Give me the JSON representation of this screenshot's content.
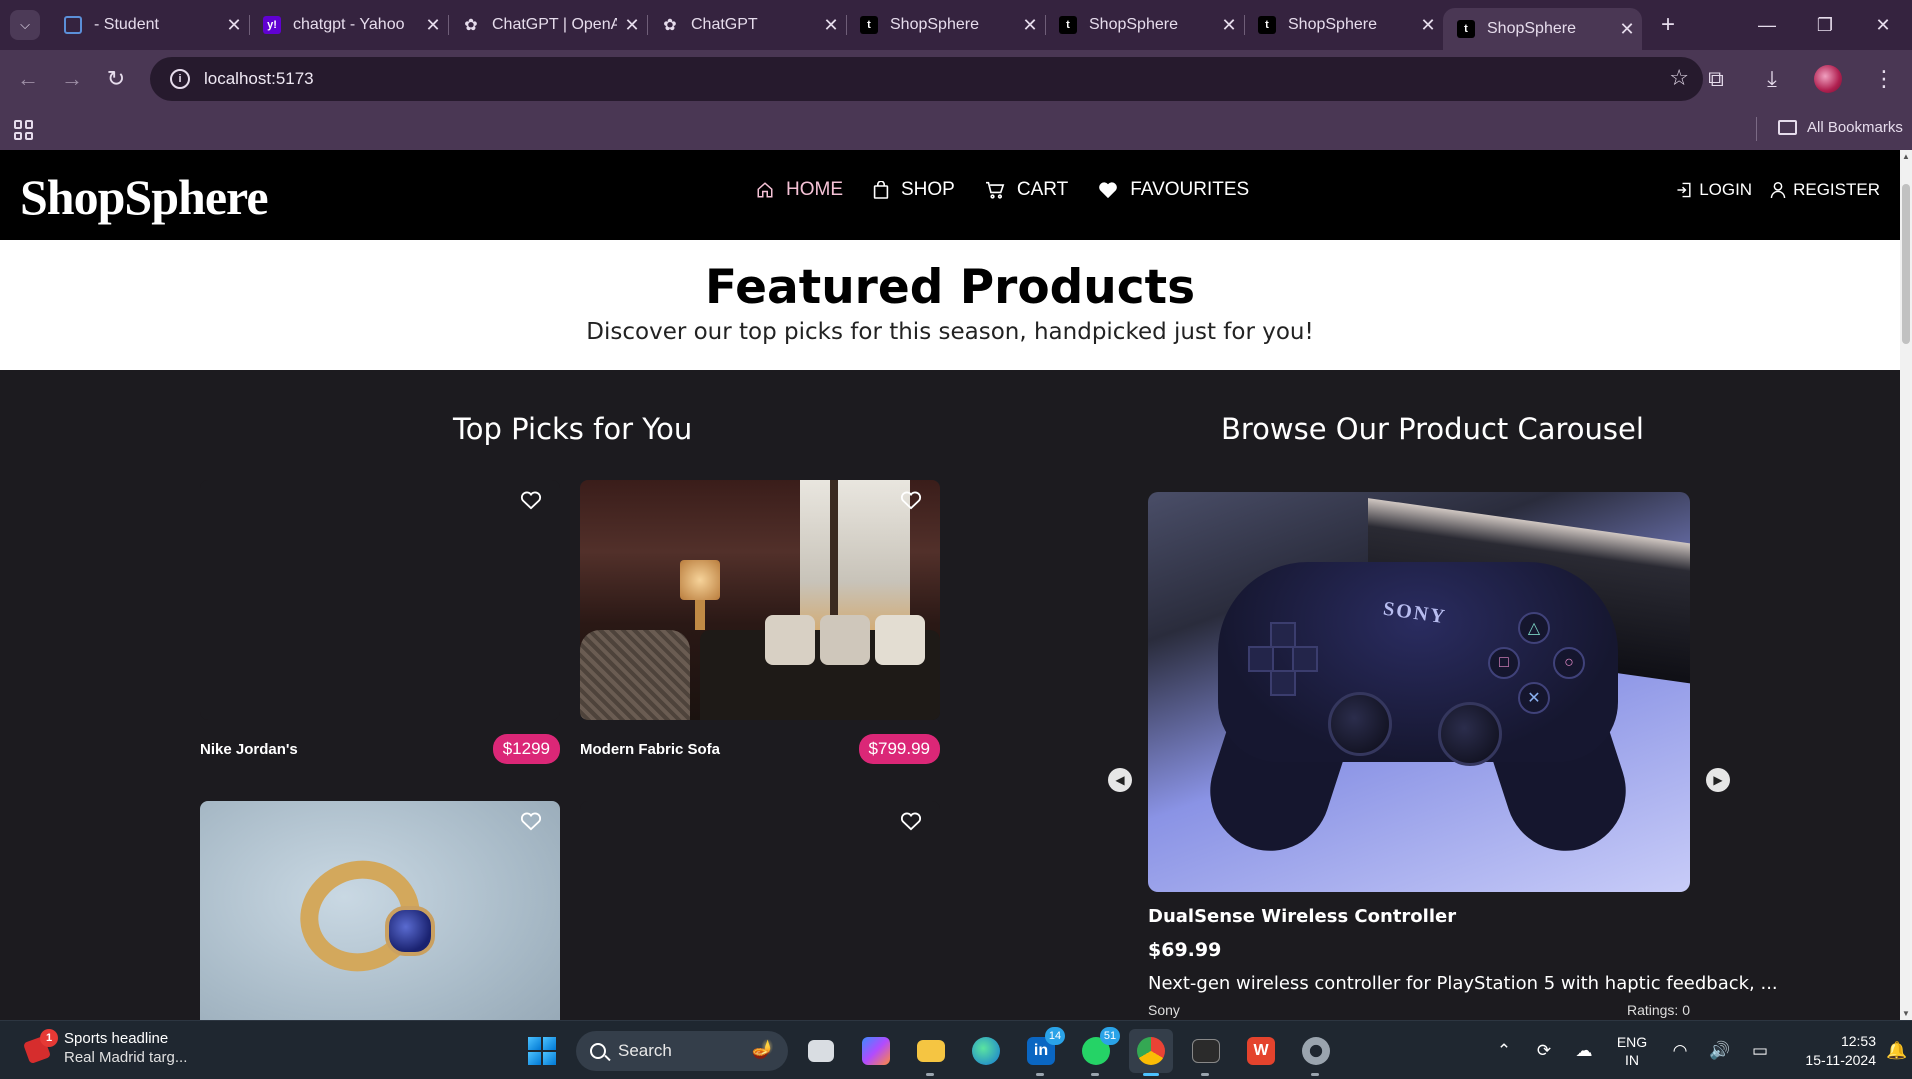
{
  "browser": {
    "tabs": [
      {
        "title": "- Student",
        "favicon": "student-icon"
      },
      {
        "title": "chatgpt - Yahoo",
        "favicon": "yahoo-icon"
      },
      {
        "title": "ChatGPT | OpenAI",
        "favicon": "openai-icon"
      },
      {
        "title": "ChatGPT",
        "favicon": "openai-icon"
      },
      {
        "title": "ShopSphere",
        "favicon": "shopsphere-icon"
      },
      {
        "title": "ShopSphere",
        "favicon": "shopsphere-icon"
      },
      {
        "title": "ShopSphere",
        "favicon": "shopsphere-icon"
      },
      {
        "title": "ShopSphere",
        "favicon": "shopsphere-icon",
        "active": true
      }
    ],
    "url": "localhost:5173",
    "bookmarks_label": "All Bookmarks"
  },
  "site": {
    "logo": "ShopSphere",
    "nav": {
      "home": "HOME",
      "shop": "SHOP",
      "cart": "CART",
      "favourites": "FAVOURITES"
    },
    "auth": {
      "login": "LOGIN",
      "register": "REGISTER"
    },
    "colors": {
      "accent": "#db2777",
      "nav_bg": "#000000",
      "page_bg": "#1c1b1f"
    }
  },
  "featured": {
    "title": "Featured Products",
    "subtitle": "Discover our top picks for this season, handpicked just for you!"
  },
  "top_picks": {
    "title": "Top Picks for You",
    "products": [
      {
        "name": "Nike Jordan's",
        "price": "$1299"
      },
      {
        "name": "Modern Fabric Sofa",
        "price": "$799.99"
      },
      {
        "name": "",
        "price": ""
      },
      {
        "name": "",
        "price": ""
      }
    ]
  },
  "carousel": {
    "title": "Browse Our Product Carousel",
    "product": {
      "name": "DualSense Wireless Controller",
      "price": "$69.99",
      "description": "Next-gen wireless controller for PlayStation 5 with haptic feedback, ...",
      "brand": "Sony",
      "ratings": "Ratings: 0",
      "image_text": "SONY"
    }
  },
  "taskbar": {
    "widget_title": "Sports headline",
    "widget_sub": "Real Madrid targ...",
    "widget_badge": "1",
    "search_label": "Search",
    "linkedin_badge": "14",
    "whatsapp_badge": "51",
    "lang_line1": "ENG",
    "lang_line2": "IN",
    "time": "12:53",
    "date": "15-11-2024"
  }
}
